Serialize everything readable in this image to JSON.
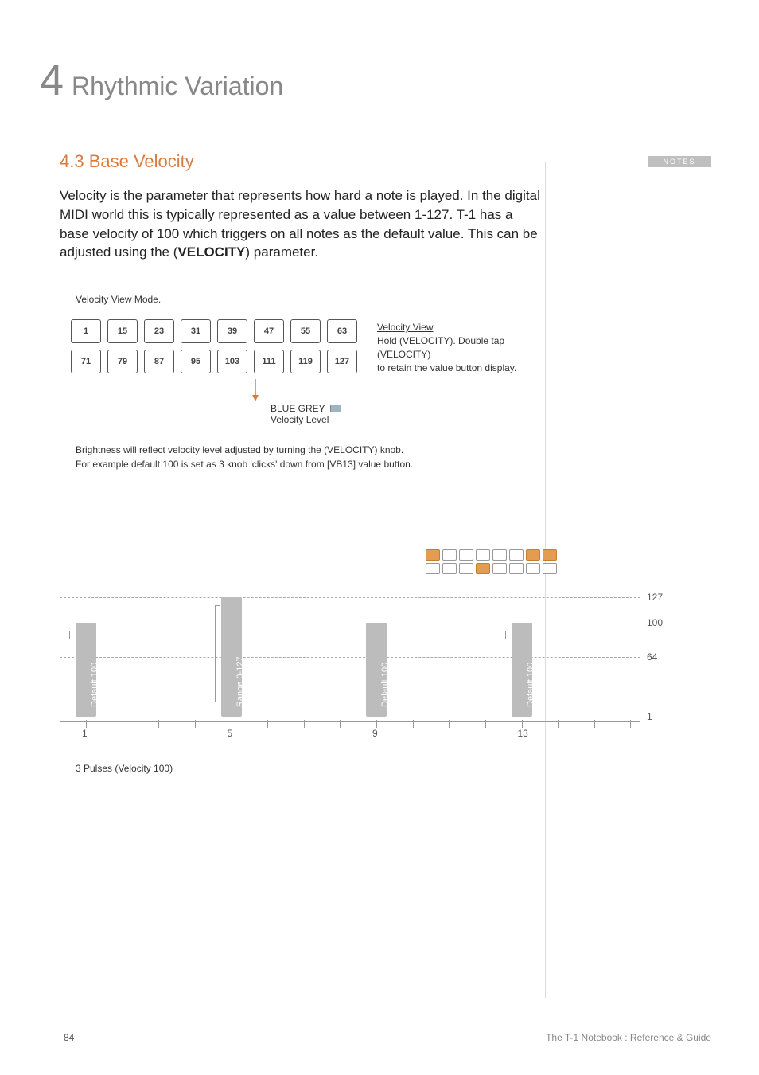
{
  "chapter": {
    "number": "4",
    "title": "Rhythmic Variation"
  },
  "section": {
    "heading": "4.3 Base Velocity"
  },
  "body": {
    "p1a": "Velocity is the parameter that represents how hard a note is played. In the digital MIDI world this is typically represented as a value between 1-127. T-1 has a base velocity of 100 which triggers on all notes as the default value. This can be adjusted using the (",
    "p1b": "VELOCITY",
    "p1c": ") parameter."
  },
  "velocity_view": {
    "mode_label": "Velocity View Mode.",
    "grid_row1": [
      "1",
      "15",
      "23",
      "31",
      "39",
      "47",
      "55",
      "63"
    ],
    "grid_row2": [
      "71",
      "79",
      "87",
      "95",
      "103",
      "111",
      "119",
      "127"
    ],
    "side_title": "Velocity View",
    "side_line1": "Hold (VELOCITY). Double tap (VELOCITY)",
    "side_line2": "to retain the value button display.",
    "legend_label": "BLUE GREY",
    "legend_sub": "Velocity Level",
    "explain1": "Brightness will reflect velocity level adjusted by turning the (VELOCITY) knob.",
    "explain2": "For example default 100 is set as 3 knob 'clicks' down from [VB13] value button."
  },
  "leds": {
    "row1": [
      "orange",
      "",
      "",
      "",
      "",
      "",
      "orange",
      "orange"
    ],
    "row2": [
      "",
      "",
      "",
      "orange",
      "",
      "",
      "",
      ""
    ]
  },
  "chart_data": {
    "type": "bar",
    "title": "3 Pulses (Velocity 100)",
    "ylabel": "",
    "ylim": [
      1,
      127
    ],
    "gridlines": [
      {
        "y": 127,
        "label": "127"
      },
      {
        "y": 100,
        "label": "100"
      },
      {
        "y": 64,
        "label": "64"
      },
      {
        "y": 1,
        "label": "1"
      }
    ],
    "x_ticks": [
      1,
      5,
      9,
      13
    ],
    "x_range": 16,
    "bars": [
      {
        "x": 1,
        "value": 100,
        "label": "Default 100"
      },
      {
        "x": 5,
        "value": 127,
        "label": "Range 0-127",
        "is_range": true
      },
      {
        "x": 9,
        "value": 100,
        "label": "Default 100"
      },
      {
        "x": 13,
        "value": 100,
        "label": "Default 100"
      }
    ],
    "caption": "3 Pulses (Velocity 100)"
  },
  "notes": {
    "label": "NOTES"
  },
  "footer": {
    "page": "84",
    "book": "The T-1 Notebook : Reference & Guide"
  }
}
